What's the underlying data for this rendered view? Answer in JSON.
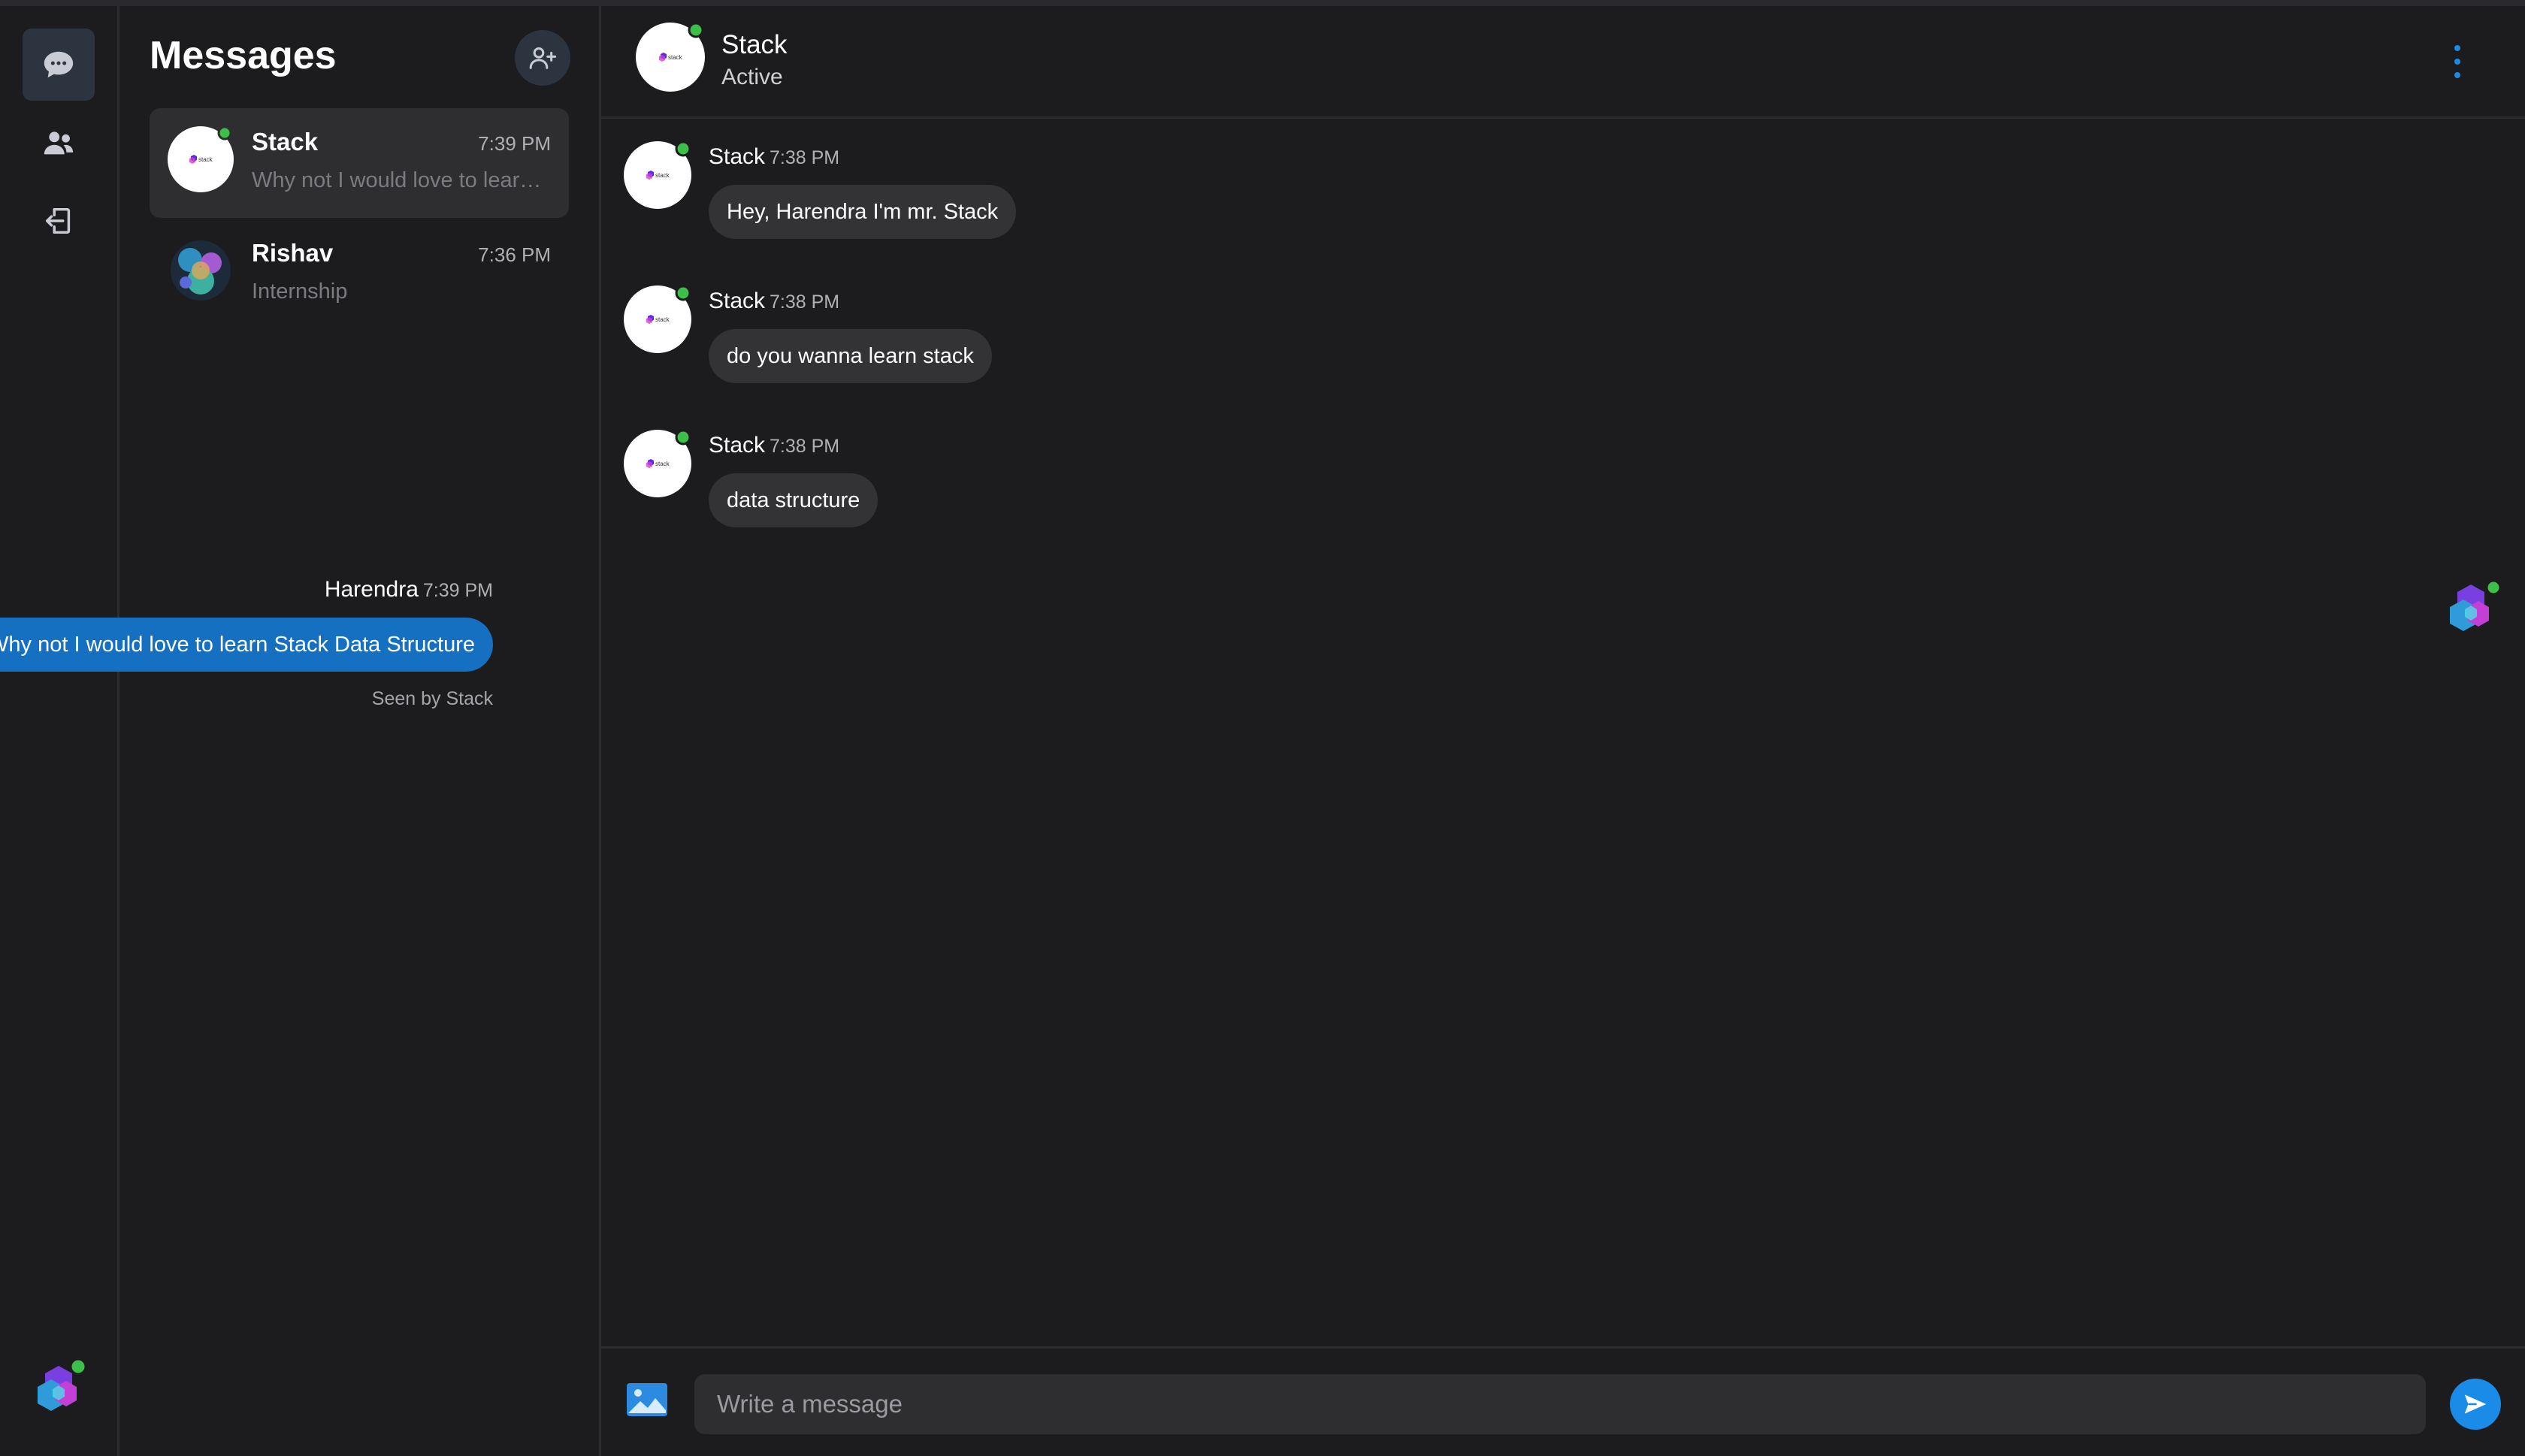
{
  "colors": {
    "background": "#1c1c1e",
    "accent": "#1a8ce8",
    "outgoing_bubble": "#1570c2",
    "incoming_bubble": "#333335",
    "online_dot": "#3cc04a"
  },
  "rail": {
    "items": [
      {
        "icon": "chat-bubble-icon",
        "active": true
      },
      {
        "icon": "people-icon",
        "active": false
      },
      {
        "icon": "logout-icon",
        "active": false
      }
    ],
    "user_avatar": "user-avatar"
  },
  "list": {
    "title": "Messages",
    "add_icon": "add-user-icon",
    "conversations": [
      {
        "name": "Stack",
        "time": "7:39 PM",
        "preview": "Why not I would love to learn Stack Data Structure",
        "selected": true
      },
      {
        "name": "Rishav",
        "time": "7:36 PM",
        "preview": "Internship",
        "selected": false
      }
    ]
  },
  "chat": {
    "header": {
      "name": "Stack",
      "status": "Active"
    },
    "messages": [
      {
        "sender": "Stack",
        "time": "7:38 PM",
        "text": "Hey, Harendra I'm mr. Stack",
        "direction": "in"
      },
      {
        "sender": "Stack",
        "time": "7:38 PM",
        "text": "do you wanna learn stack",
        "direction": "in"
      },
      {
        "sender": "Stack",
        "time": "7:38 PM",
        "text": "data structure",
        "direction": "in"
      },
      {
        "sender": "Harendra",
        "time": "7:39 PM",
        "text": "Why not I would love to learn Stack Data Structure",
        "direction": "out",
        "seen": "Seen by Stack"
      }
    ],
    "composer": {
      "placeholder": "Write a message"
    }
  }
}
